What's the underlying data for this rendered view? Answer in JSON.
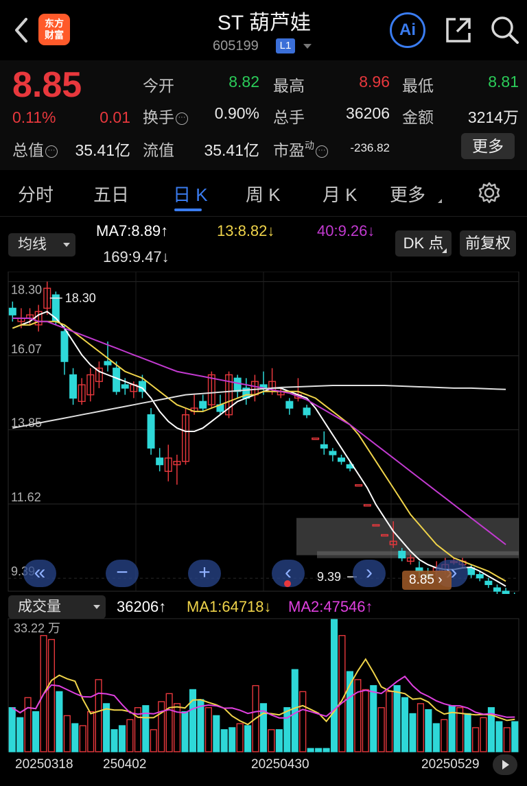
{
  "header": {
    "logo_line1": "东方",
    "logo_line2": "财富",
    "stock_name": "ST 葫芦娃",
    "stock_code": "605199",
    "level_badge": "L1",
    "ai_label": "Ai",
    "icons": [
      "back-arrow-icon",
      "share-icon",
      "search-icon"
    ]
  },
  "quote": {
    "price": "8.85",
    "change_pct": "0.11%",
    "change": "0.01",
    "open_label": "今开",
    "open": "8.82",
    "high_label": "最高",
    "high": "8.96",
    "low_label": "最低",
    "low": "8.81",
    "turnover_label": "换手",
    "turnover": "0.90%",
    "volume_label": "总手",
    "volume": "36206",
    "amount_label": "金额",
    "amount": "3214万",
    "mcap_label": "总值",
    "mcap": "35.41亿",
    "float_label": "流值",
    "float_mcap": "35.41亿",
    "pe_label": "市盈",
    "pe_sup": "动",
    "pe": "-236.82",
    "more_label": "更多",
    "colors": {
      "up": "#e8383d",
      "down": "#2bcc59",
      "accent": "#3a7cf0"
    }
  },
  "tabs": [
    {
      "label": "分时",
      "active": false
    },
    {
      "label": "五日",
      "active": false
    },
    {
      "label": "日 K",
      "active": true
    },
    {
      "label": "周 K",
      "active": false
    },
    {
      "label": "月 K",
      "active": false
    },
    {
      "label": "更多",
      "active": false
    }
  ],
  "ma_bar": {
    "selector": "均线",
    "ma7": "MA7:8.89",
    "ma13": "13:8.82",
    "ma40": "40:9.26",
    "ma169": "169:9.47",
    "arrow_up": "↑",
    "arrow_down": "↓",
    "dk_label": "DK 点",
    "adjust_label": "前复权",
    "colors": {
      "ma7": "#ffffff",
      "ma13": "#f0d44a",
      "ma40": "#c23ad0",
      "ma169": "#e0e0e0"
    }
  },
  "chart_data": [
    {
      "type": "candlestick",
      "y_ticks": [
        "18.30",
        "16.07",
        "13.85",
        "11.62",
        "9.39"
      ],
      "ylim": [
        9.0,
        18.6
      ],
      "max_annotation": "18.30",
      "min_annotation": "9.39",
      "last_price_tag": "8.85",
      "x_dates": [
        "20250318",
        "20250402",
        "20250430",
        "20250529"
      ],
      "candles": [
        [
          17.5,
          17.3,
          17.7,
          17.1
        ],
        [
          17.1,
          17.2,
          17.5,
          16.9
        ],
        [
          17.2,
          17.3,
          17.5,
          17.0
        ],
        [
          17.0,
          17.4,
          17.6,
          16.8
        ],
        [
          17.5,
          18.1,
          18.3,
          17.3
        ],
        [
          17.9,
          17.1,
          18.0,
          17.0
        ],
        [
          16.8,
          15.9,
          17.0,
          15.5
        ],
        [
          15.5,
          14.8,
          15.7,
          14.6
        ],
        [
          14.7,
          15.2,
          15.4,
          14.6
        ],
        [
          14.9,
          15.5,
          15.7,
          14.7
        ],
        [
          15.3,
          15.7,
          15.9,
          15.1
        ],
        [
          15.9,
          15.8,
          16.5,
          15.6
        ],
        [
          15.7,
          15.0,
          15.9,
          14.9
        ],
        [
          15.2,
          15.1,
          15.4,
          14.9
        ],
        [
          15.0,
          15.2,
          15.3,
          14.8
        ],
        [
          15.3,
          15.0,
          15.5,
          14.8
        ],
        [
          14.3,
          13.3,
          14.5,
          13.1
        ],
        [
          13.0,
          12.8,
          13.3,
          12.6
        ],
        [
          12.6,
          13.0,
          13.4,
          12.3
        ],
        [
          12.8,
          12.9,
          13.1,
          12.2
        ],
        [
          12.9,
          14.3,
          14.5,
          12.8
        ],
        [
          14.4,
          14.5,
          14.9,
          14.3
        ],
        [
          14.7,
          14.5,
          14.9,
          14.4
        ],
        [
          14.6,
          15.5,
          15.6,
          14.5
        ],
        [
          14.6,
          14.4,
          14.9,
          14.3
        ],
        [
          14.3,
          15.5,
          15.6,
          14.2
        ],
        [
          15.4,
          15.0,
          15.5,
          14.8
        ],
        [
          15.1,
          14.8,
          15.4,
          14.6
        ],
        [
          14.9,
          15.3,
          15.5,
          14.7
        ],
        [
          15.2,
          15.1,
          15.6,
          14.9
        ],
        [
          15.0,
          15.3,
          15.7,
          14.9
        ],
        [
          14.9,
          15.0,
          15.1,
          14.8
        ],
        [
          14.7,
          14.5,
          14.8,
          14.3
        ],
        [
          14.8,
          14.9,
          15.4,
          14.7
        ],
        [
          14.5,
          14.3,
          14.6,
          14.2
        ],
        [
          13.6,
          13.6,
          13.6,
          13.6
        ],
        [
          13.4,
          13.3,
          13.8,
          13.1
        ],
        [
          13.2,
          13.1,
          13.3,
          12.9
        ],
        [
          13.0,
          12.9,
          13.1,
          12.8
        ],
        [
          12.8,
          12.7,
          12.9,
          12.6
        ],
        [
          12.2,
          12.2,
          12.2,
          12.2
        ],
        [
          11.6,
          11.6,
          11.6,
          11.6
        ],
        [
          11.0,
          11.0,
          11.0,
          11.0
        ],
        [
          10.7,
          10.7,
          10.7,
          10.7
        ],
        [
          10.4,
          10.5,
          11.1,
          10.3
        ],
        [
          10.2,
          10.0,
          10.3,
          9.9
        ],
        [
          9.9,
          10.0,
          10.1,
          9.8
        ],
        [
          9.7,
          9.6,
          9.9,
          9.4
        ],
        [
          9.5,
          9.4,
          9.7,
          9.39
        ],
        [
          9.6,
          9.7,
          9.9,
          9.5
        ],
        [
          9.6,
          9.8,
          10.0,
          9.5
        ],
        [
          9.9,
          9.9,
          10.0,
          9.8
        ],
        [
          9.8,
          9.9,
          10.0,
          9.7
        ],
        [
          9.7,
          9.5,
          9.8,
          9.4
        ],
        [
          9.5,
          9.4,
          9.6,
          9.3
        ],
        [
          9.3,
          9.2,
          9.4,
          9.1
        ],
        [
          9.1,
          9.0,
          9.2,
          8.9
        ],
        [
          9.0,
          8.9,
          9.1,
          8.85
        ],
        [
          8.9,
          8.85,
          8.96,
          8.81
        ]
      ],
      "ma_series": [
        {
          "name": "MA7",
          "color": "#ffffff",
          "values": [
            16.9,
            17.0,
            17.1,
            17.3,
            17.4,
            17.2,
            16.9,
            16.5,
            16.1,
            15.8,
            15.6,
            15.5,
            15.4,
            15.3,
            15.2,
            15.1,
            14.8,
            14.4,
            14.1,
            13.9,
            13.8,
            13.8,
            13.9,
            14.1,
            14.3,
            14.5,
            14.7,
            14.8,
            14.9,
            15.0,
            15.1,
            15.1,
            15.0,
            14.9,
            14.8,
            14.5,
            14.1,
            13.7,
            13.3,
            12.9,
            12.5,
            12.1,
            11.6,
            11.2,
            10.8,
            10.5,
            10.2,
            9.95,
            9.8,
            9.7,
            9.65,
            9.65,
            9.7,
            9.72,
            9.6,
            9.45,
            9.3,
            9.15,
            8.89
          ]
        },
        {
          "name": "MA13",
          "color": "#f0d44a",
          "values": [
            16.9,
            17.0,
            17.0,
            17.1,
            17.1,
            17.1,
            17.0,
            16.8,
            16.6,
            16.4,
            16.2,
            16.0,
            15.8,
            15.6,
            15.5,
            15.4,
            15.2,
            15.0,
            14.8,
            14.6,
            14.5,
            14.4,
            14.4,
            14.5,
            14.6,
            14.7,
            14.8,
            14.9,
            14.9,
            15.0,
            15.0,
            15.0,
            15.0,
            15.0,
            14.9,
            14.8,
            14.6,
            14.4,
            14.2,
            14.0,
            13.7,
            13.3,
            12.9,
            12.5,
            12.1,
            11.7,
            11.3,
            11.0,
            10.7,
            10.4,
            10.2,
            10.0,
            9.9,
            9.8,
            9.7,
            9.6,
            9.45,
            9.3,
            8.82
          ]
        },
        {
          "name": "MA40",
          "color": "#c23ad0",
          "values": [
            17.2,
            17.2,
            17.2,
            17.1,
            17.1,
            17.0,
            16.9,
            16.8,
            16.7,
            16.6,
            16.5,
            16.4,
            16.3,
            16.2,
            16.1,
            16.0,
            15.9,
            15.8,
            15.7,
            15.6,
            15.55,
            15.5,
            15.45,
            15.4,
            15.35,
            15.3,
            15.25,
            15.2,
            15.15,
            15.1,
            15.05,
            15.0,
            14.95,
            14.85,
            14.75,
            14.6,
            14.45,
            14.3,
            14.15,
            14.0,
            13.8,
            13.6,
            13.4,
            13.2,
            13.0,
            12.8,
            12.6,
            12.4,
            12.2,
            12.0,
            11.8,
            11.6,
            11.4,
            11.2,
            11.0,
            10.8,
            10.6,
            10.4,
            9.26
          ]
        },
        {
          "name": "MA169",
          "color": "#e0e0e0",
          "values": [
            13.9,
            13.95,
            14.0,
            14.05,
            14.1,
            14.15,
            14.2,
            14.25,
            14.3,
            14.35,
            14.4,
            14.45,
            14.5,
            14.55,
            14.6,
            14.65,
            14.7,
            14.75,
            14.8,
            14.85,
            14.9,
            14.92,
            14.94,
            14.96,
            14.98,
            15.0,
            15.02,
            15.04,
            15.06,
            15.08,
            15.1,
            15.12,
            15.13,
            15.14,
            15.15,
            15.16,
            15.17,
            15.18,
            15.18,
            15.18,
            15.18,
            15.18,
            15.18,
            15.18,
            15.17,
            15.16,
            15.15,
            15.14,
            15.13,
            15.12,
            15.11,
            15.1,
            15.1,
            15.1,
            15.09,
            15.08,
            15.07,
            15.06,
            9.47
          ]
        }
      ]
    },
    {
      "type": "bar",
      "title": "成交量",
      "y_max_label": "33.22 万",
      "ylim": [
        0,
        33.22
      ],
      "values": [
        11,
        8.5,
        13.5,
        10,
        29,
        28,
        15,
        9,
        7,
        6.5,
        10,
        18,
        12,
        5.5,
        6.5,
        8,
        11,
        11.5,
        5.5,
        12.5,
        14.5,
        12,
        10,
        15.5,
        13,
        11,
        9,
        5.5,
        6,
        7,
        6.5,
        16.5,
        12,
        5.5,
        5.5,
        11,
        20.5,
        15,
        0.8,
        0.8,
        0.8,
        33,
        29,
        20,
        18,
        15.5,
        16.5,
        11,
        15,
        16.5,
        13.5,
        9.5,
        12,
        10.5,
        7,
        8,
        11.5,
        11,
        9.5,
        6,
        8.5,
        11,
        7.5,
        6,
        7.5
      ],
      "ups": [
        false,
        false,
        true,
        false,
        true,
        true,
        false,
        true,
        false,
        true,
        true,
        true,
        false,
        false,
        false,
        true,
        true,
        false,
        true,
        true,
        true,
        true,
        false,
        false,
        false,
        true,
        false,
        false,
        false,
        true,
        false,
        true,
        false,
        true,
        false,
        false,
        false,
        true,
        false,
        false,
        false,
        false,
        true,
        false,
        true,
        true,
        false,
        true,
        true,
        false,
        false,
        false,
        true,
        false,
        false,
        true,
        false,
        true,
        false,
        true,
        true,
        false,
        false,
        true
      ],
      "ma_series": [
        {
          "name": "MA1",
          "color": "#f0d44a"
        },
        {
          "name": "MA2",
          "color": "#e040e0"
        }
      ]
    }
  ],
  "volume_bar": {
    "selector": "成交量",
    "vol": "36206",
    "ma1": "MA1:64718",
    "ma2": "MA2:47546",
    "arrow_up": "↑",
    "arrow_down": "↓"
  },
  "dates": [
    "20250318",
    "250402",
    "20250430",
    "20250529"
  ],
  "controls": [
    "«",
    "−",
    "+",
    "‹",
    "›",
    "»"
  ]
}
